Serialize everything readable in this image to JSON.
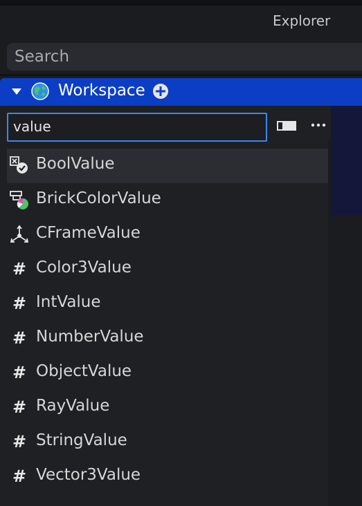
{
  "panel": {
    "title": "Explorer"
  },
  "search": {
    "placeholder": "Search"
  },
  "workspace": {
    "label": "Workspace"
  },
  "insert": {
    "query": "value",
    "items": [
      {
        "label": "BoolValue",
        "icon": "bool-value-icon"
      },
      {
        "label": "BrickColorValue",
        "icon": "brick-color-value-icon"
      },
      {
        "label": "CFrameValue",
        "icon": "cframe-value-icon"
      },
      {
        "label": "Color3Value",
        "icon": "hash-icon"
      },
      {
        "label": "IntValue",
        "icon": "hash-icon"
      },
      {
        "label": "NumberValue",
        "icon": "hash-icon"
      },
      {
        "label": "ObjectValue",
        "icon": "hash-icon"
      },
      {
        "label": "RayValue",
        "icon": "hash-icon"
      },
      {
        "label": "StringValue",
        "icon": "hash-icon"
      },
      {
        "label": "Vector3Value",
        "icon": "hash-icon"
      }
    ]
  },
  "colors": {
    "accent": "#0b3ec4",
    "focus_border": "#3c88f0",
    "background": "#1b1c20"
  }
}
